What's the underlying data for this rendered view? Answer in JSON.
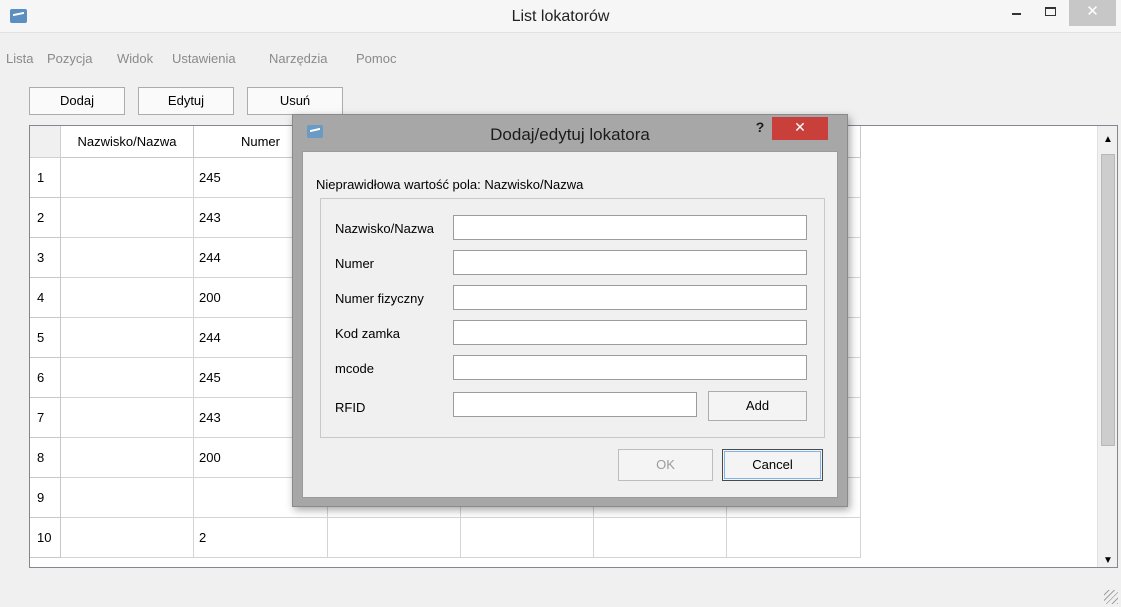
{
  "window": {
    "title": "List lokatorów",
    "close_glyph": "✕"
  },
  "menu": [
    "Lista",
    "Pozycja",
    "Widok",
    "Ustawienia",
    "Narzędzia",
    "Pomoc"
  ],
  "toolbar": {
    "add_label": "Dodaj",
    "edit_label": "Edytuj",
    "delete_label": "Usuń"
  },
  "table": {
    "columns": [
      "Nazwisko/Nazwa",
      "Numer"
    ],
    "rows": [
      {
        "index": "1",
        "name": "",
        "number": "245"
      },
      {
        "index": "2",
        "name": "",
        "number": "243"
      },
      {
        "index": "3",
        "name": "",
        "number": "244"
      },
      {
        "index": "4",
        "name": "",
        "number": "200"
      },
      {
        "index": "5",
        "name": "",
        "number": "244"
      },
      {
        "index": "6",
        "name": "",
        "number": "245"
      },
      {
        "index": "7",
        "name": "",
        "number": "243"
      },
      {
        "index": "8",
        "name": "",
        "number": "200"
      },
      {
        "index": "9",
        "name": "",
        "number": ""
      },
      {
        "index": "10",
        "name": "",
        "number": "2"
      }
    ]
  },
  "dialog": {
    "title": "Dodaj/edytuj lokatora",
    "help_glyph": "?",
    "close_glyph": "✕",
    "error_message": "Nieprawidłowa wartość pola: Nazwisko/Nazwa",
    "fields": [
      {
        "label": "Nazwisko/Nazwa",
        "value": ""
      },
      {
        "label": "Numer",
        "value": ""
      },
      {
        "label": "Numer fizyczny",
        "value": ""
      },
      {
        "label": "Kod zamka",
        "value": ""
      },
      {
        "label": "mcode",
        "value": ""
      },
      {
        "label": "RFID",
        "value": ""
      }
    ],
    "add_label": "Add",
    "ok_label": "OK",
    "cancel_label": "Cancel"
  },
  "icons": {
    "app": "app-icon",
    "help": "help-icon",
    "close": "close-icon",
    "minimize": "minimize-icon",
    "maximize": "maximize-icon"
  },
  "colors": {
    "dialog_close": "#c9403a",
    "window_close": "#c7c7c7",
    "disabled_text": "#9b9b9b"
  }
}
